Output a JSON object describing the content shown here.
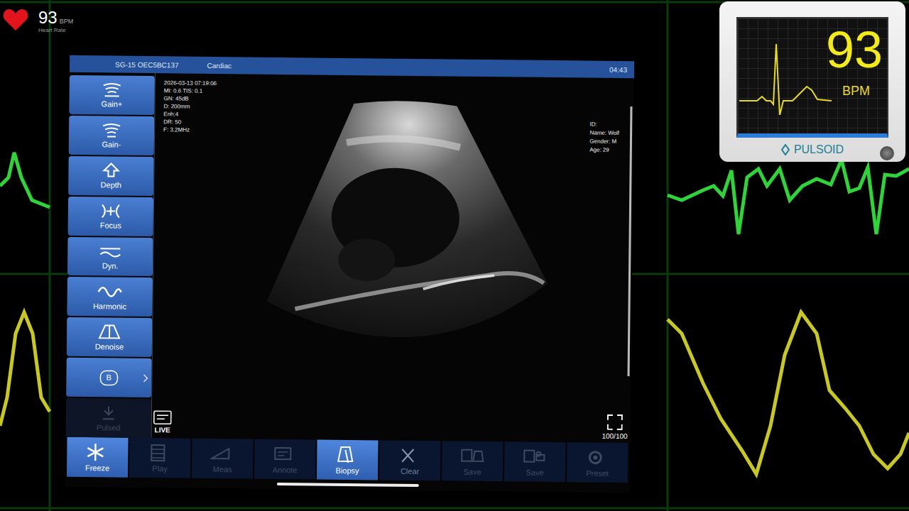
{
  "heart_widget": {
    "value": "93",
    "unit": "BPM",
    "caption": "Heart Rate"
  },
  "monitor": {
    "value": "93",
    "unit": "BPM",
    "brand": "PULSOID"
  },
  "tablet": {
    "device": "SG-15 OEC5BC137",
    "preset": "Cardiac",
    "time": "04:43",
    "params": [
      "2026-03-13 07:19:06",
      "MI: 0.6  TIS: 0.1",
      "GN: 45dB",
      "D: 200mm",
      "Enh:4",
      "DR: 50",
      "F: 3.2MHz"
    ],
    "patient": [
      "ID:",
      "Name: Wolf",
      "Gender: M",
      "Age: 29"
    ],
    "sidebar": {
      "items": [
        {
          "label": "Gain+",
          "disabled": false
        },
        {
          "label": "Gain-",
          "disabled": false
        },
        {
          "label": "Depth",
          "disabled": false
        },
        {
          "label": "Focus",
          "disabled": false
        },
        {
          "label": "Dyn.",
          "disabled": false
        },
        {
          "label": "Harmonic",
          "disabled": false
        },
        {
          "label": "Denoise",
          "disabled": false
        },
        {
          "label": "B",
          "disabled": false
        },
        {
          "label": "Pulsed",
          "disabled": true
        }
      ]
    },
    "live": "LIVE",
    "frames": "100/100",
    "toolbar": [
      {
        "label": "Freeze",
        "selected": true,
        "disabled": false
      },
      {
        "label": "Play",
        "selected": false,
        "disabled": true
      },
      {
        "label": "Meas",
        "selected": false,
        "disabled": true
      },
      {
        "label": "Annote",
        "selected": false,
        "disabled": true
      },
      {
        "label": "Biopsy",
        "selected": true,
        "disabled": false
      },
      {
        "label": "Clear",
        "selected": false,
        "disabled": false
      },
      {
        "label": "Save",
        "selected": false,
        "disabled": true
      },
      {
        "label": "Save",
        "selected": false,
        "disabled": true
      },
      {
        "label": "Preset",
        "selected": false,
        "disabled": true
      }
    ]
  }
}
